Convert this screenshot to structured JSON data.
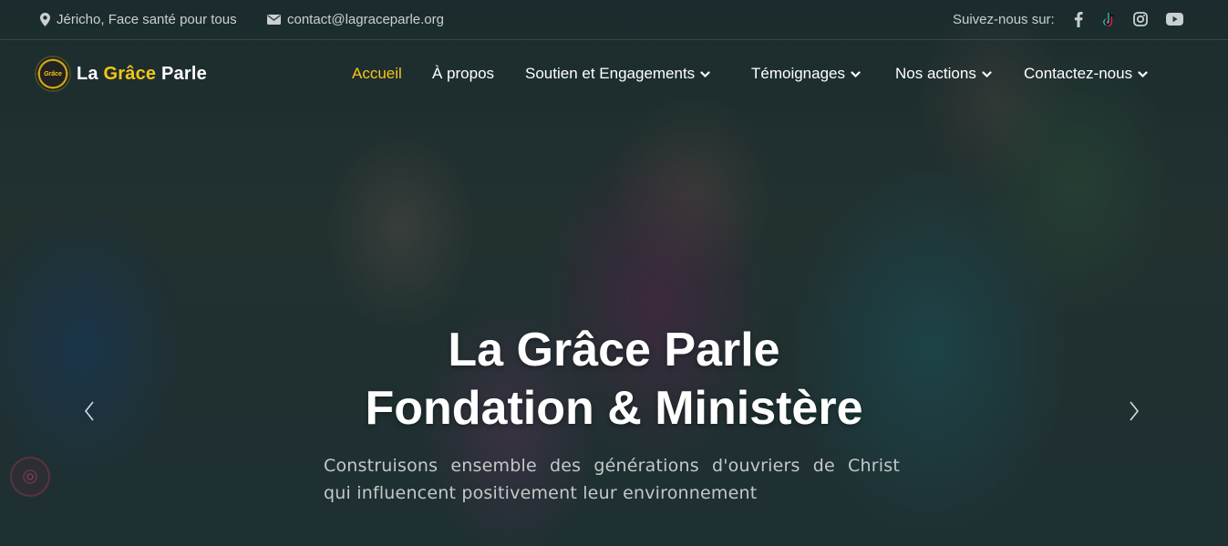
{
  "topbar": {
    "location": "Jéricho, Face santé pour tous",
    "email": "contact@lagraceparle.org",
    "social_label": "Suivez-nous sur:",
    "social_icons": [
      "facebook-icon",
      "tiktok-icon",
      "instagram-icon",
      "youtube-icon"
    ]
  },
  "logo": {
    "badge_text": "Grâce",
    "part1": "La ",
    "part2": "Grâce",
    "part3": " Parle"
  },
  "nav": {
    "home": "Accueil",
    "about": "À propos",
    "support": "Soutien et Engagements",
    "testimonies": "Témoignages",
    "actions": "Nos actions",
    "contact": "Contactez-nous"
  },
  "hero": {
    "title_line1": "La Grâce Parle",
    "title_line2": "Fondation & Ministère",
    "subtitle_line1": "Construisons ensemble des générations d'ouvriers de Christ",
    "subtitle_line2": "qui influencent positivement leur environnement"
  },
  "colors": {
    "accent": "#f4c518",
    "text_muted": "#c9d0d0",
    "overlay": "#1d2f2f"
  }
}
